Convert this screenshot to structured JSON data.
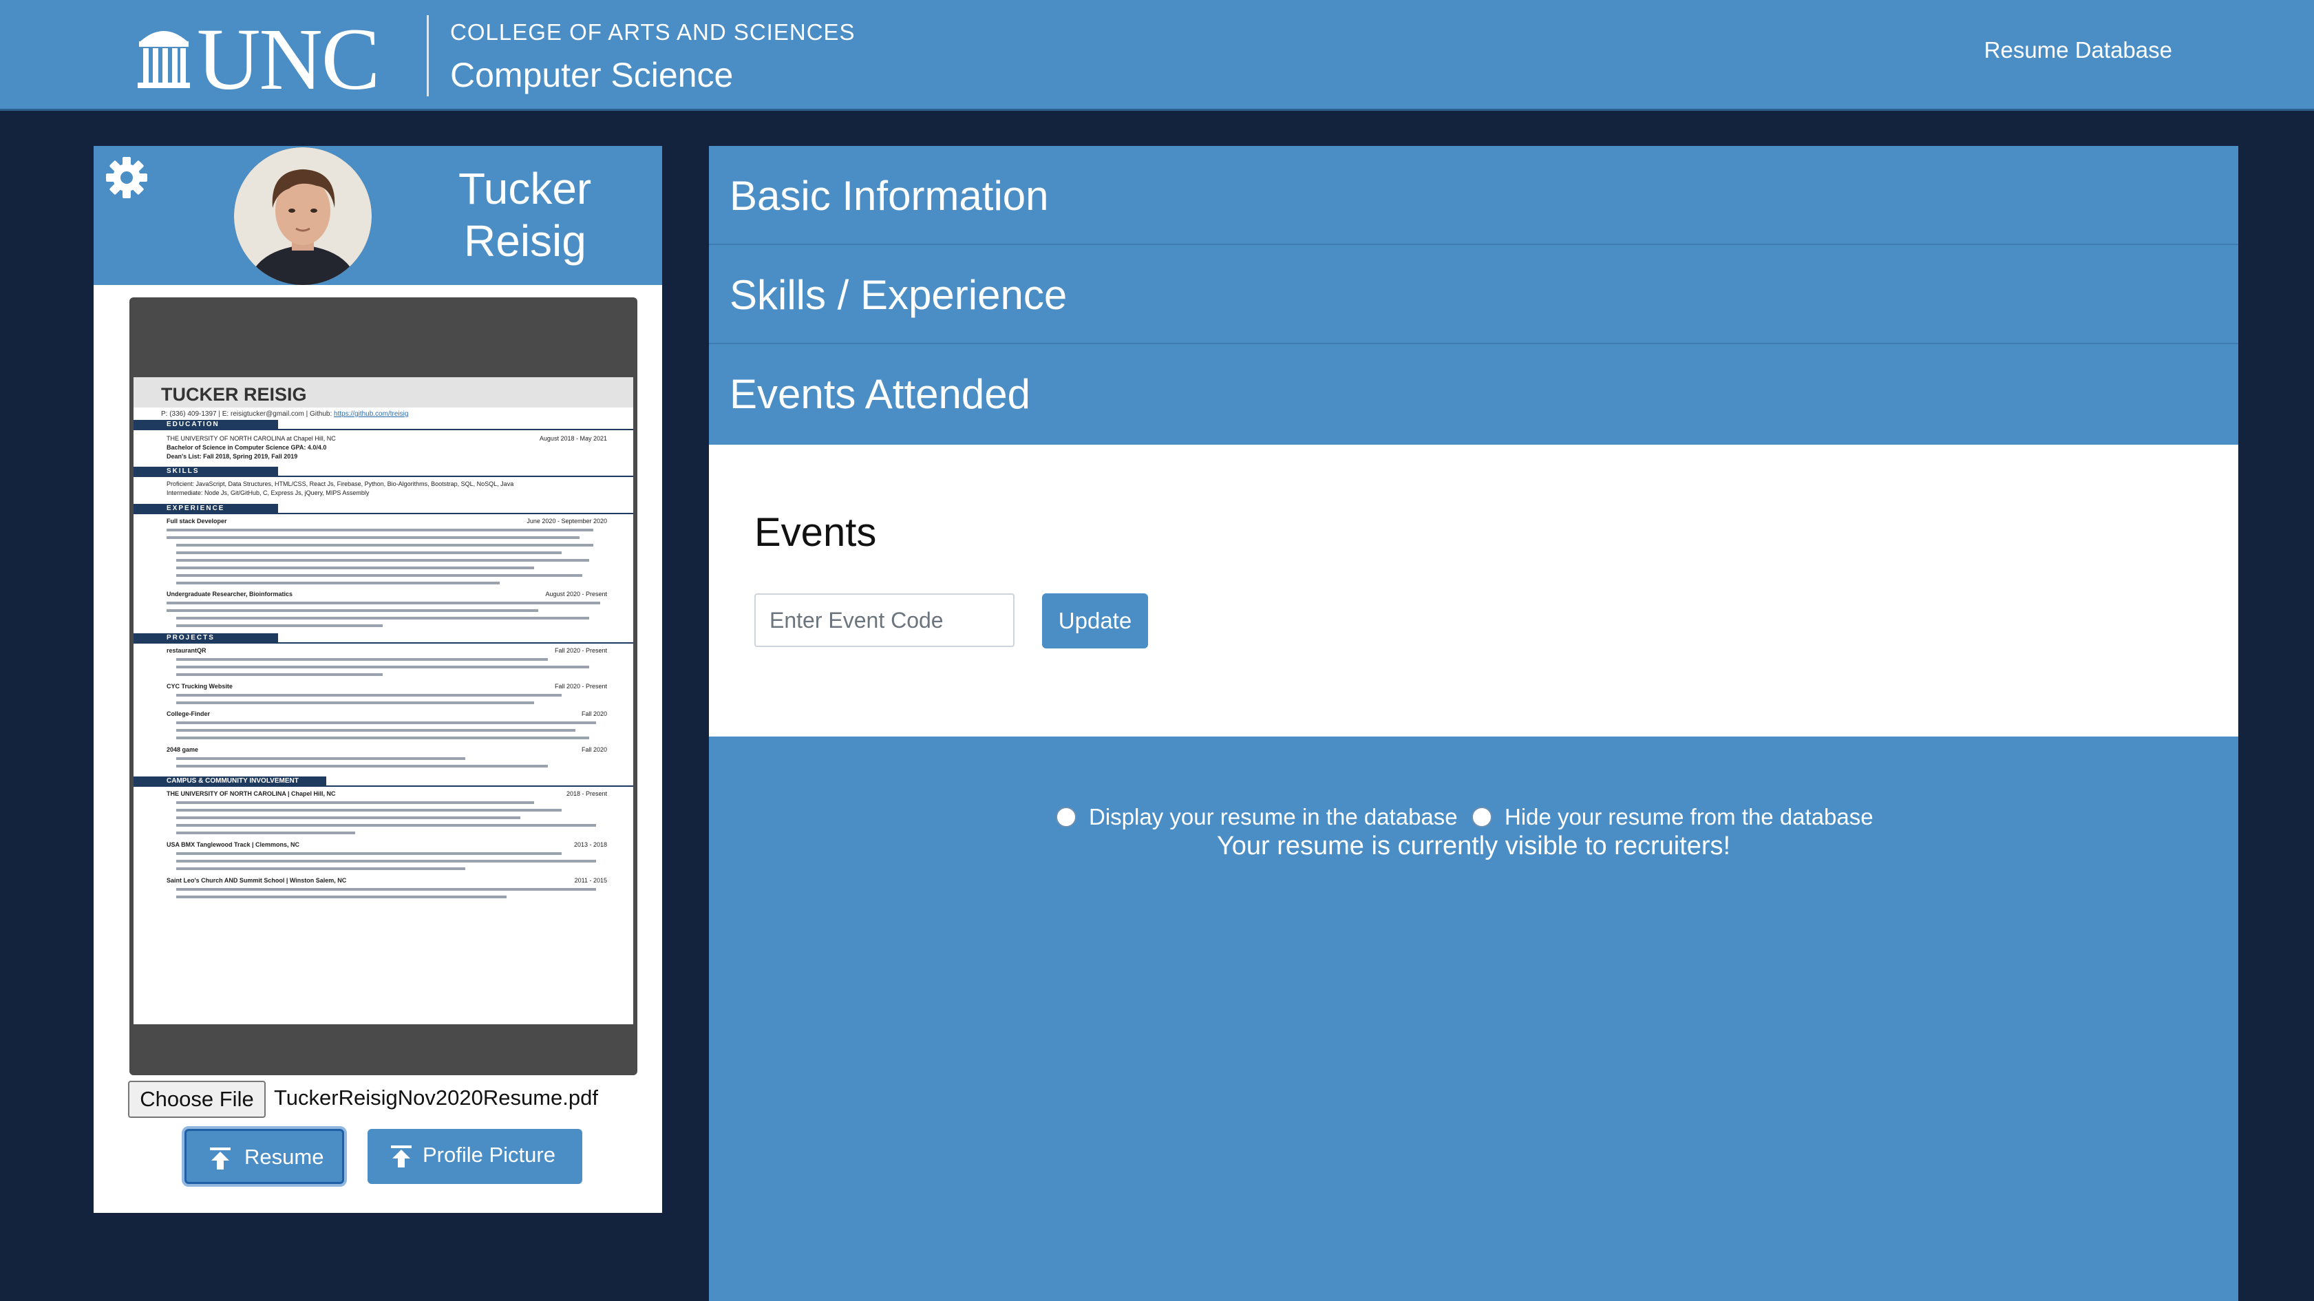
{
  "header": {
    "logo_text": "UNC",
    "college": "COLLEGE OF ARTS AND SCIENCES",
    "department": "Computer Science",
    "nav_link": "Resume Database"
  },
  "profile": {
    "first_name": "Tucker",
    "last_name": "Reisig"
  },
  "resume_preview": {
    "name": "TUCKER REISIG",
    "contact": "P: (336) 409-1397 | E: reisigtucker@gmail.com | Github: ",
    "github": "https://github.com/treisig",
    "sections": {
      "education": "EDUCATION",
      "skills": "SKILLS",
      "experience": "EXPERIENCE",
      "projects": "PROJECTS",
      "involvement": "CAMPUS & COMMUNITY INVOLVEMENT"
    },
    "education": {
      "school": "THE UNIVERSITY OF NORTH CAROLINA at Chapel Hill, NC",
      "dates": "August 2018 - May 2021",
      "degree": "Bachelor of Science in Computer Science GPA: 4.0/4.0",
      "deans": "Dean's List: Fall 2018, Spring 2019, Fall 2019"
    },
    "skills": {
      "proficient": "Proficient: JavaScript, Data Structures, HTML/CSS, React Js, Firebase, Python, Bio-Algorithms, Bootstrap, SQL, NoSQL, Java",
      "intermediate": "Intermediate: Node Js, Git/GitHub, C, Express Js, jQuery, MIPS Assembly"
    },
    "experience": [
      {
        "title": "Full stack Developer",
        "dates": "June 2020 - September 2020"
      },
      {
        "title": "Undergraduate Researcher, Bioinformatics",
        "dates": "August 2020 - Present"
      }
    ],
    "projects": [
      {
        "title": "restaurantQR",
        "dates": "Fall 2020 - Present"
      },
      {
        "title": "CYC Trucking Website",
        "dates": "Fall 2020 - Present"
      },
      {
        "title": "College-Finder",
        "dates": "Fall 2020"
      },
      {
        "title": "2048 game",
        "dates": "Fall 2020"
      }
    ],
    "involvement": [
      {
        "title": "THE UNIVERSITY OF NORTH CAROLINA | Chapel Hill, NC",
        "dates": "2018 - Present"
      },
      {
        "title": "USA BMX Tanglewood Track | Clemmons, NC",
        "dates": "2013 - 2018"
      },
      {
        "title": "Saint Leo's Church AND Summit School | Winston Salem, NC",
        "dates": "2011 - 2015"
      }
    ]
  },
  "file_input": {
    "button_label": "Choose File",
    "file_name": "TuckerReisigNov2020Resume.pdf"
  },
  "upload_buttons": {
    "resume": "Resume",
    "profile_picture": "Profile Picture"
  },
  "sections": {
    "basic_info": "Basic Information",
    "skills": "Skills / Experience",
    "events": "Events Attended"
  },
  "events": {
    "title": "Events",
    "placeholder": "Enter Event Code",
    "update_button": "Update"
  },
  "visibility": {
    "display_option": "Display your resume in the database",
    "hide_option": "Hide your resume from the database",
    "status": "Your resume is currently visible to recruiters!"
  },
  "icons": {
    "settings": "gear-icon",
    "upload": "upload-arrow-icon",
    "logo": "old-well-icon"
  }
}
